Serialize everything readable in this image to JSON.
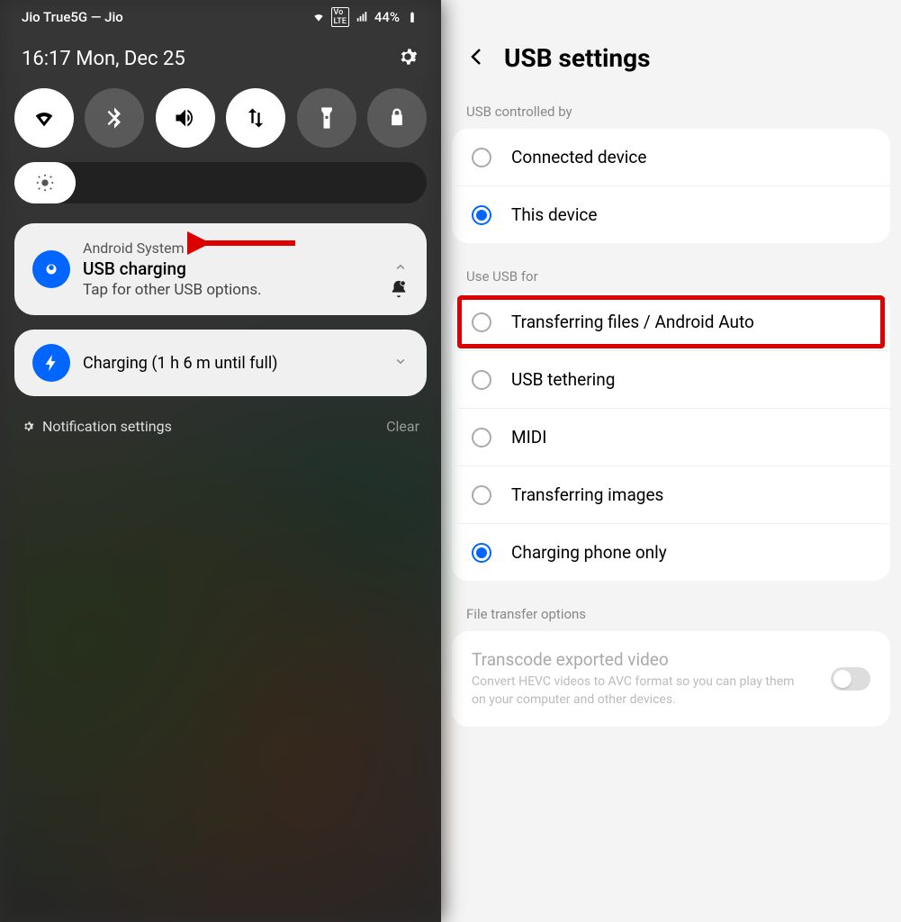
{
  "left": {
    "status_carrier": "Jio True5G — Jio",
    "status_battery": "44%",
    "date_time": "16:17  Mon, Dec 25",
    "notif1": {
      "source": "Android System",
      "title": "USB charging",
      "sub": "Tap for other USB options."
    },
    "notif2": {
      "title": "Charging (1 h 6 m until full)"
    },
    "notif_settings": "Notification settings",
    "clear": "Clear"
  },
  "right": {
    "title": "USB settings",
    "section1_label": "USB controlled by",
    "section1": [
      {
        "label": "Connected device",
        "checked": false
      },
      {
        "label": "This device",
        "checked": true
      }
    ],
    "section2_label": "Use USB for",
    "section2": [
      {
        "label": "Transferring files / Android Auto",
        "checked": false,
        "highlight": true
      },
      {
        "label": "USB tethering",
        "checked": false
      },
      {
        "label": "MIDI",
        "checked": false
      },
      {
        "label": "Transferring images",
        "checked": false
      },
      {
        "label": "Charging phone only",
        "checked": true
      }
    ],
    "section3_label": "File transfer options",
    "section3": {
      "title": "Transcode exported video",
      "desc": "Convert HEVC videos to AVC format so you can play them on your computer and other devices."
    }
  }
}
